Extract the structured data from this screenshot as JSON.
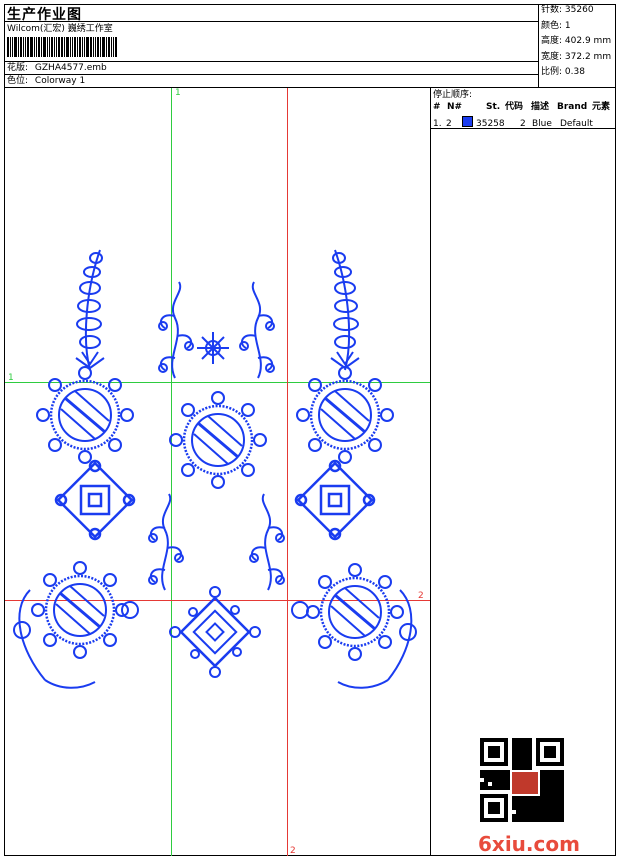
{
  "header": {
    "title": "生产作业图",
    "studio": "Wilcom(汇宏) 巍绣工作室",
    "design_file_label": "花版:",
    "design_file": "GZHA4577.emb",
    "colorway_label": "色位:",
    "colorway": "Colorway 1"
  },
  "stats": {
    "stitches_label": "针数:",
    "stitches": "35260",
    "colors_label": "颜色:",
    "colors": "1",
    "height_label": "高度:",
    "height": "402.9 mm",
    "width_label": "宽度:",
    "width": "372.2 mm",
    "scale_label": "比例:",
    "scale": "0.38"
  },
  "stop_sequence": {
    "title": "停止顺序:",
    "columns": [
      "#",
      "N#",
      "St.",
      "代码",
      "描述",
      "Brand",
      "元素"
    ],
    "rows": [
      {
        "index": "1.",
        "needle": "2",
        "stitches": "35258",
        "code": "2",
        "description": "Blue",
        "brand": "Default",
        "swatch": "#1a3cf0"
      }
    ]
  },
  "canvas": {
    "thread_color": "#1a3cf0",
    "guide_color_1": "#2ecc40",
    "guide_color_2": "#e53935",
    "guide_labels": {
      "top_green": "1",
      "left_green": "1",
      "right_red": "2",
      "bottom_red": "2"
    }
  },
  "watermark": {
    "text": "6xiu.com"
  }
}
